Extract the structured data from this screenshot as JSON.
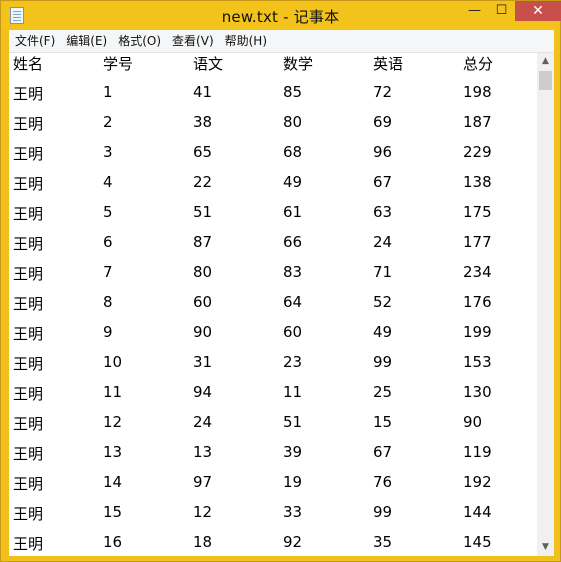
{
  "window": {
    "title": "new.txt - 记事本",
    "min_glyph": "—",
    "max_glyph": "☐",
    "close_glyph": "✕"
  },
  "menu": [
    "文件(F)",
    "编辑(E)",
    "格式(O)",
    "查看(V)",
    "帮助(H)"
  ],
  "table": {
    "headers": [
      "姓名",
      "学号",
      "语文",
      "数学",
      "英语",
      "总分"
    ],
    "rows": [
      [
        "王明",
        "1",
        "41",
        "85",
        "72",
        "198"
      ],
      [
        "王明",
        "2",
        "38",
        "80",
        "69",
        "187"
      ],
      [
        "王明",
        "3",
        "65",
        "68",
        "96",
        "229"
      ],
      [
        "王明",
        "4",
        "22",
        "49",
        "67",
        "138"
      ],
      [
        "王明",
        "5",
        "51",
        "61",
        "63",
        "175"
      ],
      [
        "王明",
        "6",
        "87",
        "66",
        "24",
        "177"
      ],
      [
        "王明",
        "7",
        "80",
        "83",
        "71",
        "234"
      ],
      [
        "王明",
        "8",
        "60",
        "64",
        "52",
        "176"
      ],
      [
        "王明",
        "9",
        "90",
        "60",
        "49",
        "199"
      ],
      [
        "王明",
        "10",
        "31",
        "23",
        "99",
        "153"
      ],
      [
        "王明",
        "11",
        "94",
        "11",
        "25",
        "130"
      ],
      [
        "王明",
        "12",
        "24",
        "51",
        "15",
        "90"
      ],
      [
        "王明",
        "13",
        "13",
        "39",
        "67",
        "119"
      ],
      [
        "王明",
        "14",
        "97",
        "19",
        "76",
        "192"
      ],
      [
        "王明",
        "15",
        "12",
        "33",
        "99",
        "144"
      ],
      [
        "王明",
        "16",
        "18",
        "92",
        "35",
        "145"
      ]
    ]
  },
  "scrollbar": {
    "up_glyph": "▲",
    "down_glyph": "▼"
  },
  "colors": {
    "titlebar": "#f3c31b",
    "close": "#c7504a",
    "menubar": "#f5f6f7",
    "text": "#000000"
  }
}
